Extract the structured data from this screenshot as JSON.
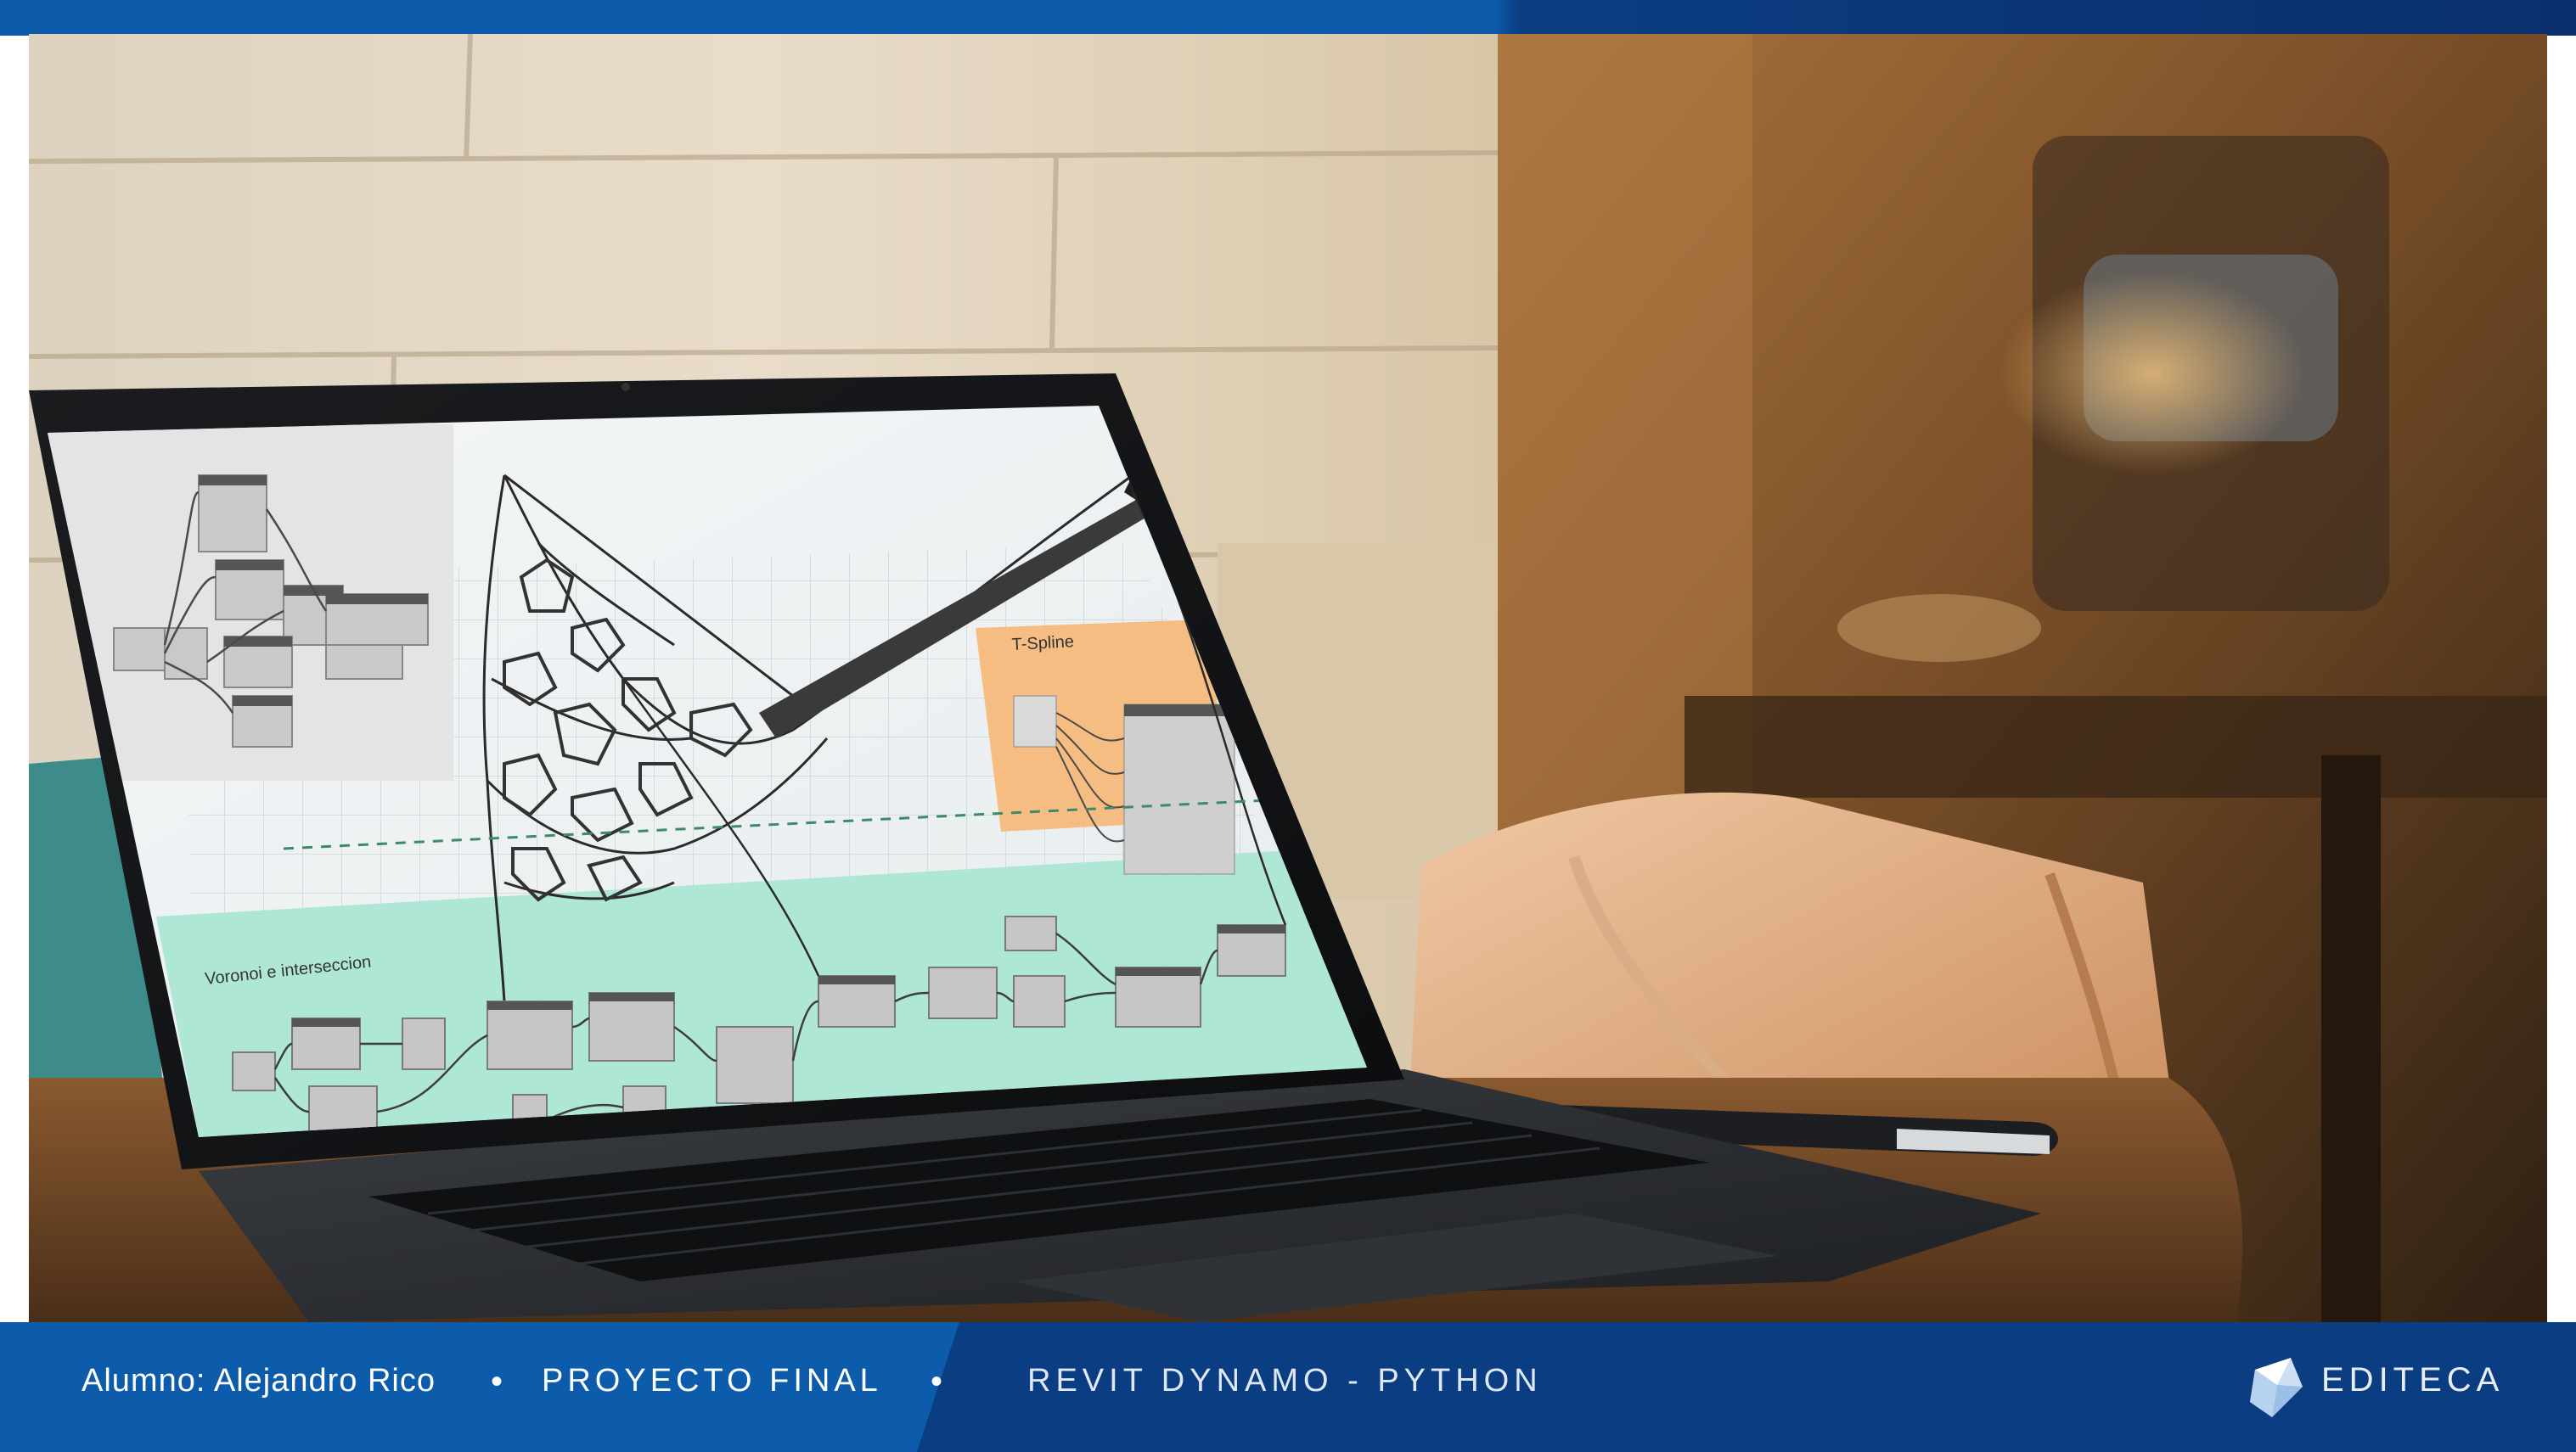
{
  "footer": {
    "student": "Alumno: Alejandro Rico",
    "separator": "•",
    "project": "PROYECTO FINAL",
    "course": "REVIT DYNAMO - PYTHON"
  },
  "brand": {
    "name": "EDITECA"
  },
  "screen": {
    "group_tspline": "T-Spline",
    "group_voronoi": "Voronoi e interseccion"
  },
  "colors": {
    "brand_blue": "#0a3d82",
    "accent_blue": "#0d5cab",
    "group_orange": "#f6b878",
    "group_teal": "#a9e6d4"
  },
  "icons": [
    "editeca-logo-icon"
  ]
}
